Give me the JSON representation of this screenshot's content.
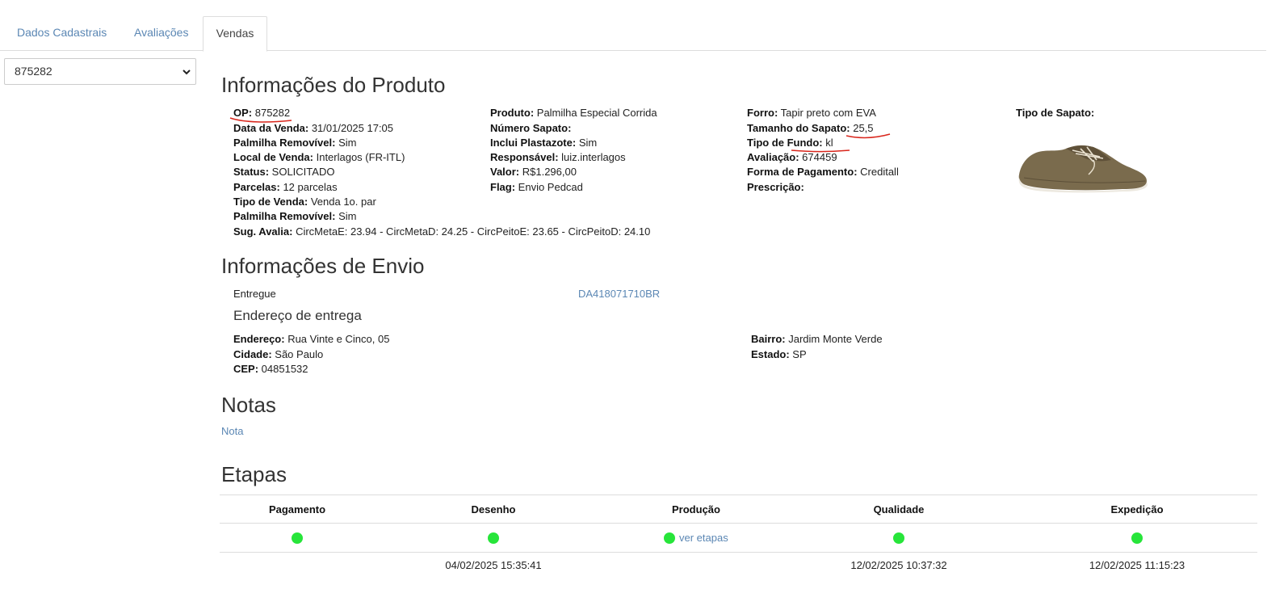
{
  "tabs": [
    {
      "label": "Dados Cadastrais"
    },
    {
      "label": "Avaliações"
    },
    {
      "label": "Vendas"
    }
  ],
  "order_select": {
    "value": "875282"
  },
  "produto": {
    "title": "Informações do Produto",
    "col1": [
      {
        "label": "OP:",
        "value": " 875282"
      },
      {
        "label": "Data da Venda:",
        "value": " 31/01/2025 17:05"
      },
      {
        "label": "Palmilha Removível:",
        "value": " Sim"
      },
      {
        "label": "Local de Venda:",
        "value": " Interlagos (FR-ITL)"
      },
      {
        "label": "Status:",
        "value": " SOLICITADO"
      },
      {
        "label": "Parcelas:",
        "value": " 12 parcelas"
      },
      {
        "label": "Tipo de Venda:",
        "value": " Venda 1o. par"
      },
      {
        "label": "Palmilha Removível:",
        "value": " Sim"
      },
      {
        "label": "Sug. Avalia:",
        "value": " CircMetaE: 23.94 - CircMetaD: 24.25 - CircPeitoE: 23.65 - CircPeitoD: 24.10"
      }
    ],
    "col2": [
      {
        "label": "Produto:",
        "value": " Palmilha Especial Corrida"
      },
      {
        "label": "Número Sapato:",
        "value": ""
      },
      {
        "label": "Inclui Plastazote:",
        "value": " Sim"
      },
      {
        "label": "Responsável:",
        "value": " luiz.interlagos"
      },
      {
        "label": "Valor:",
        "value": " R$1.296,00"
      },
      {
        "label": "Flag:",
        "value": " Envio Pedcad"
      }
    ],
    "col3": [
      {
        "label": "Forro:",
        "value": " Tapir preto com EVA"
      },
      {
        "label": "Tamanho do Sapato:",
        "value": " 25,5"
      },
      {
        "label": "Tipo de Fundo:",
        "value": " kl"
      },
      {
        "label": "Avaliação:",
        "value": " 674459"
      },
      {
        "label": "Forma de Pagamento:",
        "value": " Creditall"
      },
      {
        "label": "Prescrição:",
        "value": ""
      }
    ],
    "shoe_type_label": "Tipo de Sapato:"
  },
  "envio": {
    "title": "Informações de Envio",
    "status": "Entregue",
    "tracking": "DA418071710BR",
    "address_title": "Endereço de entrega",
    "left": [
      {
        "label": "Endereço:",
        "value": " Rua Vinte e Cinco, 05"
      },
      {
        "label": "Cidade:",
        "value": " São Paulo"
      },
      {
        "label": "CEP:",
        "value": " 04851532"
      }
    ],
    "right": [
      {
        "label": "Bairro:",
        "value": " Jardim Monte Verde"
      },
      {
        "label": "Estado:",
        "value": " SP"
      }
    ]
  },
  "notas": {
    "title": "Notas",
    "link": "Nota"
  },
  "etapas": {
    "title": "Etapas",
    "columns": [
      {
        "name": "Pagamento",
        "status_color": "#27e53a",
        "link": "",
        "date": ""
      },
      {
        "name": "Desenho",
        "status_color": "#27e53a",
        "link": "",
        "date": "04/02/2025 15:35:41"
      },
      {
        "name": "Produção",
        "status_color": "#27e53a",
        "link": "ver etapas",
        "date": ""
      },
      {
        "name": "Qualidade",
        "status_color": "#27e53a",
        "link": "",
        "date": "12/02/2025 10:37:32"
      },
      {
        "name": "Expedição",
        "status_color": "#27e53a",
        "link": "",
        "date": "12/02/2025 11:15:23"
      }
    ]
  }
}
